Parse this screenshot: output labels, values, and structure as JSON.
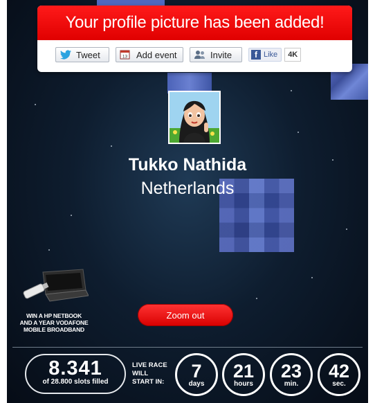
{
  "popup": {
    "message": "Your profile picture has been added!",
    "tweet_label": "Tweet",
    "add_event_label": "Add event",
    "calendar_day": "13",
    "invite_label": "Invite",
    "fb_like_label": "Like",
    "fb_like_count": "4K"
  },
  "profile": {
    "name": "Tukko Nathida",
    "country": "Netherlands"
  },
  "promo": {
    "line1": "WIN A HP NETBOOK",
    "line2": "AND A YEAR VODAFONE",
    "line3": "MOBILE BROADBAND"
  },
  "zoom_out_label": "Zoom out",
  "counter": {
    "slots_filled": "8.341",
    "slots_total_text": "of 28.800 slots filled",
    "live_race_line1": "LIVE RACE",
    "live_race_line2": "WILL",
    "live_race_line3": "START IN:",
    "days": "7",
    "days_unit": "days",
    "hours": "21",
    "hours_unit": "hours",
    "minutes": "23",
    "minutes_unit": "min.",
    "seconds": "42",
    "seconds_unit": "sec."
  },
  "colors": {
    "brand_red": "#e60000",
    "background": "#0e1d2f",
    "facebook": "#3b5998"
  }
}
